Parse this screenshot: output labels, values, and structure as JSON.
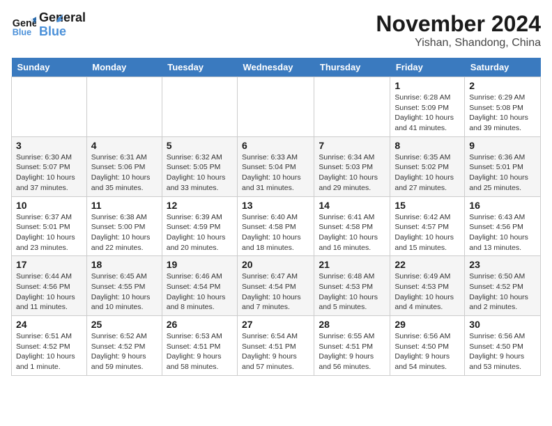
{
  "header": {
    "logo_general": "General",
    "logo_blue": "Blue",
    "month": "November 2024",
    "location": "Yishan, Shandong, China"
  },
  "weekdays": [
    "Sunday",
    "Monday",
    "Tuesday",
    "Wednesday",
    "Thursday",
    "Friday",
    "Saturday"
  ],
  "weeks": [
    [
      {
        "day": "",
        "details": ""
      },
      {
        "day": "",
        "details": ""
      },
      {
        "day": "",
        "details": ""
      },
      {
        "day": "",
        "details": ""
      },
      {
        "day": "",
        "details": ""
      },
      {
        "day": "1",
        "details": "Sunrise: 6:28 AM\nSunset: 5:09 PM\nDaylight: 10 hours\nand 41 minutes."
      },
      {
        "day": "2",
        "details": "Sunrise: 6:29 AM\nSunset: 5:08 PM\nDaylight: 10 hours\nand 39 minutes."
      }
    ],
    [
      {
        "day": "3",
        "details": "Sunrise: 6:30 AM\nSunset: 5:07 PM\nDaylight: 10 hours\nand 37 minutes."
      },
      {
        "day": "4",
        "details": "Sunrise: 6:31 AM\nSunset: 5:06 PM\nDaylight: 10 hours\nand 35 minutes."
      },
      {
        "day": "5",
        "details": "Sunrise: 6:32 AM\nSunset: 5:05 PM\nDaylight: 10 hours\nand 33 minutes."
      },
      {
        "day": "6",
        "details": "Sunrise: 6:33 AM\nSunset: 5:04 PM\nDaylight: 10 hours\nand 31 minutes."
      },
      {
        "day": "7",
        "details": "Sunrise: 6:34 AM\nSunset: 5:03 PM\nDaylight: 10 hours\nand 29 minutes."
      },
      {
        "day": "8",
        "details": "Sunrise: 6:35 AM\nSunset: 5:02 PM\nDaylight: 10 hours\nand 27 minutes."
      },
      {
        "day": "9",
        "details": "Sunrise: 6:36 AM\nSunset: 5:01 PM\nDaylight: 10 hours\nand 25 minutes."
      }
    ],
    [
      {
        "day": "10",
        "details": "Sunrise: 6:37 AM\nSunset: 5:01 PM\nDaylight: 10 hours\nand 23 minutes."
      },
      {
        "day": "11",
        "details": "Sunrise: 6:38 AM\nSunset: 5:00 PM\nDaylight: 10 hours\nand 22 minutes."
      },
      {
        "day": "12",
        "details": "Sunrise: 6:39 AM\nSunset: 4:59 PM\nDaylight: 10 hours\nand 20 minutes."
      },
      {
        "day": "13",
        "details": "Sunrise: 6:40 AM\nSunset: 4:58 PM\nDaylight: 10 hours\nand 18 minutes."
      },
      {
        "day": "14",
        "details": "Sunrise: 6:41 AM\nSunset: 4:58 PM\nDaylight: 10 hours\nand 16 minutes."
      },
      {
        "day": "15",
        "details": "Sunrise: 6:42 AM\nSunset: 4:57 PM\nDaylight: 10 hours\nand 15 minutes."
      },
      {
        "day": "16",
        "details": "Sunrise: 6:43 AM\nSunset: 4:56 PM\nDaylight: 10 hours\nand 13 minutes."
      }
    ],
    [
      {
        "day": "17",
        "details": "Sunrise: 6:44 AM\nSunset: 4:56 PM\nDaylight: 10 hours\nand 11 minutes."
      },
      {
        "day": "18",
        "details": "Sunrise: 6:45 AM\nSunset: 4:55 PM\nDaylight: 10 hours\nand 10 minutes."
      },
      {
        "day": "19",
        "details": "Sunrise: 6:46 AM\nSunset: 4:54 PM\nDaylight: 10 hours\nand 8 minutes."
      },
      {
        "day": "20",
        "details": "Sunrise: 6:47 AM\nSunset: 4:54 PM\nDaylight: 10 hours\nand 7 minutes."
      },
      {
        "day": "21",
        "details": "Sunrise: 6:48 AM\nSunset: 4:53 PM\nDaylight: 10 hours\nand 5 minutes."
      },
      {
        "day": "22",
        "details": "Sunrise: 6:49 AM\nSunset: 4:53 PM\nDaylight: 10 hours\nand 4 minutes."
      },
      {
        "day": "23",
        "details": "Sunrise: 6:50 AM\nSunset: 4:52 PM\nDaylight: 10 hours\nand 2 minutes."
      }
    ],
    [
      {
        "day": "24",
        "details": "Sunrise: 6:51 AM\nSunset: 4:52 PM\nDaylight: 10 hours\nand 1 minute."
      },
      {
        "day": "25",
        "details": "Sunrise: 6:52 AM\nSunset: 4:52 PM\nDaylight: 9 hours\nand 59 minutes."
      },
      {
        "day": "26",
        "details": "Sunrise: 6:53 AM\nSunset: 4:51 PM\nDaylight: 9 hours\nand 58 minutes."
      },
      {
        "day": "27",
        "details": "Sunrise: 6:54 AM\nSunset: 4:51 PM\nDaylight: 9 hours\nand 57 minutes."
      },
      {
        "day": "28",
        "details": "Sunrise: 6:55 AM\nSunset: 4:51 PM\nDaylight: 9 hours\nand 56 minutes."
      },
      {
        "day": "29",
        "details": "Sunrise: 6:56 AM\nSunset: 4:50 PM\nDaylight: 9 hours\nand 54 minutes."
      },
      {
        "day": "30",
        "details": "Sunrise: 6:56 AM\nSunset: 4:50 PM\nDaylight: 9 hours\nand 53 minutes."
      }
    ]
  ]
}
